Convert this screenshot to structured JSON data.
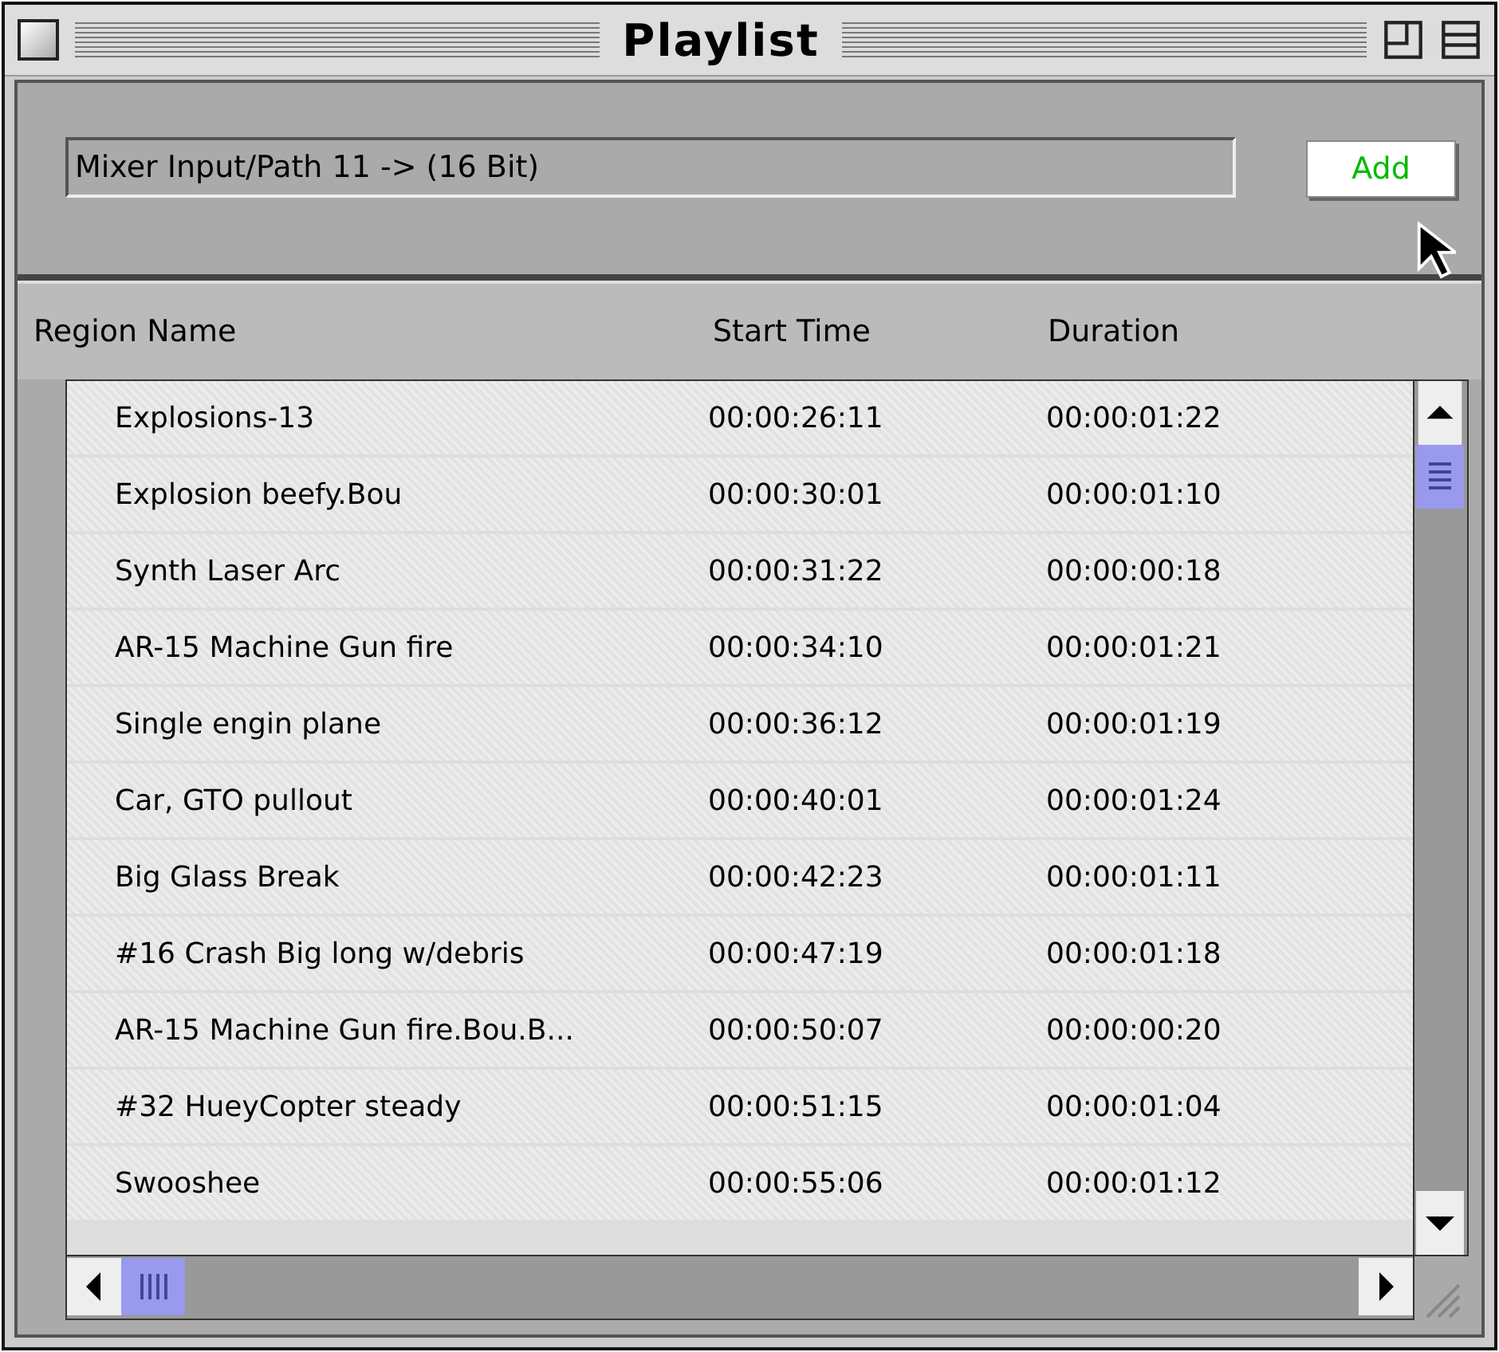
{
  "window": {
    "title": "Playlist"
  },
  "source_field": {
    "value": "Mixer Input/Path 11 -> (16 Bit)"
  },
  "add_button": {
    "label": "Add"
  },
  "table": {
    "columns": [
      "Region Name",
      "Start Time",
      "Duration"
    ],
    "rows": [
      {
        "name": "Explosions-13",
        "start": "00:00:26:11",
        "duration": "00:00:01:22"
      },
      {
        "name": "Explosion beefy.Bou",
        "start": "00:00:30:01",
        "duration": "00:00:01:10"
      },
      {
        "name": "Synth Laser Arc",
        "start": "00:00:31:22",
        "duration": "00:00:00:18"
      },
      {
        "name": "AR-15 Machine Gun fire",
        "start": "00:00:34:10",
        "duration": "00:00:01:21"
      },
      {
        "name": "Single engin plane",
        "start": "00:00:36:12",
        "duration": "00:00:01:19"
      },
      {
        "name": "Car, GTO pullout",
        "start": "00:00:40:01",
        "duration": "00:00:01:24"
      },
      {
        "name": "Big Glass Break",
        "start": "00:00:42:23",
        "duration": "00:00:01:11"
      },
      {
        "name": "#16 Crash Big long w/debris",
        "start": "00:00:47:19",
        "duration": "00:00:01:18"
      },
      {
        "name": "AR-15 Machine Gun fire.Bou.B...",
        "start": "00:00:50:07",
        "duration": "00:00:00:20"
      },
      {
        "name": "#32 HueyCopter steady",
        "start": "00:00:51:15",
        "duration": "00:00:01:04"
      },
      {
        "name": "Swooshee",
        "start": "00:00:55:06",
        "duration": "00:00:01:12"
      }
    ]
  }
}
